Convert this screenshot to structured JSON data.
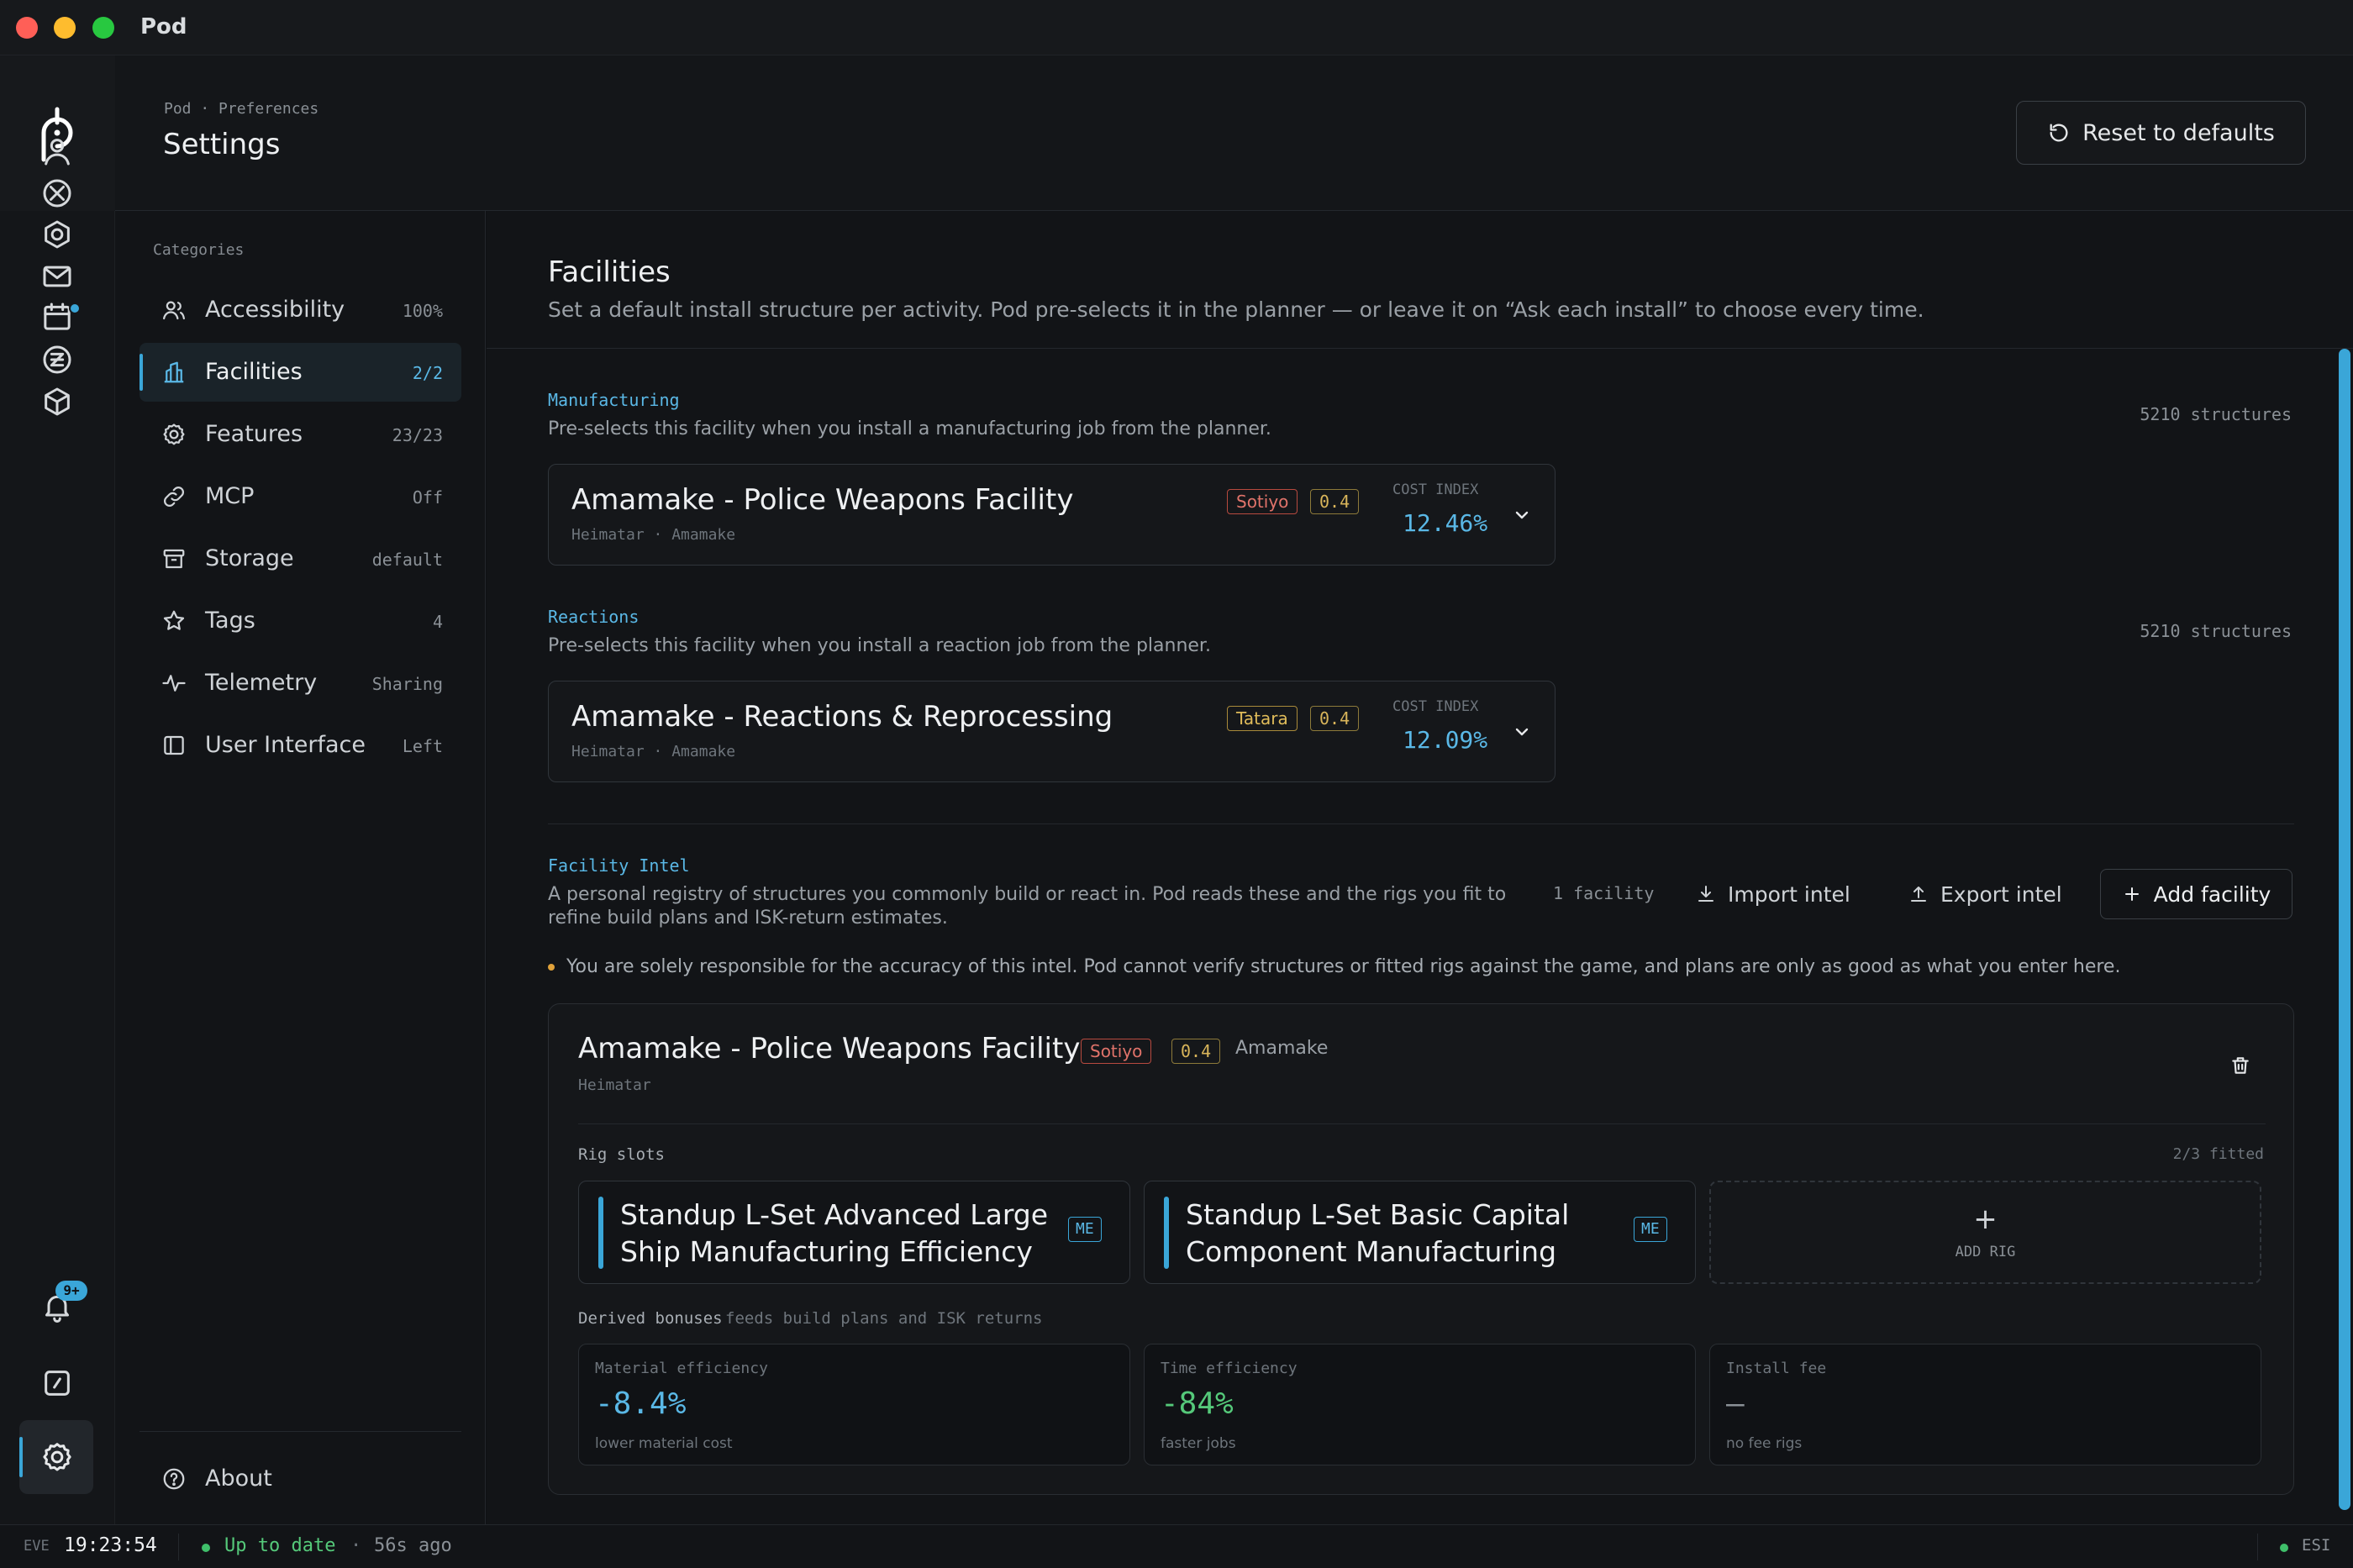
{
  "window": {
    "title": "Pod"
  },
  "colors": {
    "accent": "#3aa6d8",
    "success": "#3fbf6a",
    "warning": "#e0a23a",
    "sotiyo": "#e0736a",
    "tatara": "#e0bc5a"
  },
  "rail": {
    "icons": [
      "user-icon",
      "x-circle-icon",
      "hexagon-icon",
      "mail-icon",
      "calendar-icon",
      "currency-icon",
      "cube-icon",
      "bell-icon",
      "terminal-icon",
      "gear-icon"
    ],
    "notification_badge": "9+"
  },
  "header": {
    "breadcrumb": "Pod · Preferences",
    "title": "Settings",
    "reset_label": "Reset to defaults"
  },
  "categories": {
    "label": "Categories",
    "items": [
      {
        "name": "Accessibility",
        "count": "100%",
        "icon": "accessibility-icon"
      },
      {
        "name": "Facilities",
        "count": "2/2",
        "icon": "building-icon"
      },
      {
        "name": "Features",
        "count": "23/23",
        "icon": "gear-icon"
      },
      {
        "name": "MCP",
        "count": "Off",
        "icon": "link-icon"
      },
      {
        "name": "Storage",
        "count": "default",
        "icon": "archive-icon"
      },
      {
        "name": "Tags",
        "count": "4",
        "icon": "star-icon"
      },
      {
        "name": "Telemetry",
        "count": "Sharing",
        "icon": "pulse-icon"
      },
      {
        "name": "User Interface",
        "count": "Left",
        "icon": "layout-icon"
      }
    ],
    "about": "About"
  },
  "main": {
    "title": "Facilities",
    "description": "Set a default install structure per activity. Pod pre-selects it in the planner — or leave it on “Ask each install” to choose every time.",
    "manufacturing": {
      "label": "Manufacturing",
      "desc": "Pre-selects this facility when you install a manufacturing job from the planner.",
      "structures": "5210 structures",
      "facility": {
        "name": "Amamake - Police Weapons Facility",
        "region": "Heimatar",
        "system": "Amamake",
        "type": "Sotiyo",
        "security": "0.4",
        "cost_index_label": "COST INDEX",
        "cost_index": "12.46%"
      }
    },
    "reactions": {
      "label": "Reactions",
      "desc": "Pre-selects this facility when you install a reaction job from the planner.",
      "structures": "5210 structures",
      "facility": {
        "name": "Amamake - Reactions & Reprocessing",
        "region": "Heimatar",
        "system": "Amamake",
        "type": "Tatara",
        "security": "0.4",
        "cost_index_label": "COST INDEX",
        "cost_index": "12.09%"
      }
    },
    "intel": {
      "label": "Facility Intel",
      "desc_line1": "A personal registry of structures you commonly build or react in. Pod reads these and the rigs you fit to",
      "desc_line2": "refine build plans and ISK-return estimates.",
      "count": "1 facility",
      "import_label": "Import intel",
      "export_label": "Export intel",
      "add_label": "Add facility",
      "warning": "You are solely responsible for the accuracy of this intel. Pod cannot verify structures or fitted rigs against the game, and plans are only as good as what you enter here.",
      "card": {
        "name": "Amamake - Police Weapons Facility",
        "type": "Sotiyo",
        "security": "0.4",
        "system": "Amamake",
        "region": "Heimatar",
        "rig_slots_label": "Rig slots",
        "fitted": "2/3 fitted",
        "rigs": [
          {
            "line1": "Standup L-Set Advanced Large",
            "line2": "Ship Manufacturing Efficiency",
            "tag": "ME"
          },
          {
            "line1": "Standup L-Set Basic Capital",
            "line2": "Component Manufacturing",
            "tag": "ME"
          }
        ],
        "add_rig_plus": "+",
        "add_rig_label": "ADD RIG",
        "derived_label": "Derived bonuses",
        "derived_note": "feeds build plans and ISK returns",
        "stats": [
          {
            "label": "Material efficiency",
            "value": "-8.4%",
            "note": "lower material cost",
            "color": "#5ab8e6"
          },
          {
            "label": "Time efficiency",
            "value": "-84%",
            "note": "faster jobs",
            "color": "#55c97a"
          },
          {
            "label": "Install fee",
            "value": "—",
            "note": "no fee rigs",
            "color": "#8a9096"
          }
        ]
      }
    }
  },
  "status": {
    "eve_label": "EVE",
    "clock": "19:23:54",
    "state": "Up to date",
    "separator": "·",
    "ago": "56s ago",
    "esi": "ESI"
  }
}
